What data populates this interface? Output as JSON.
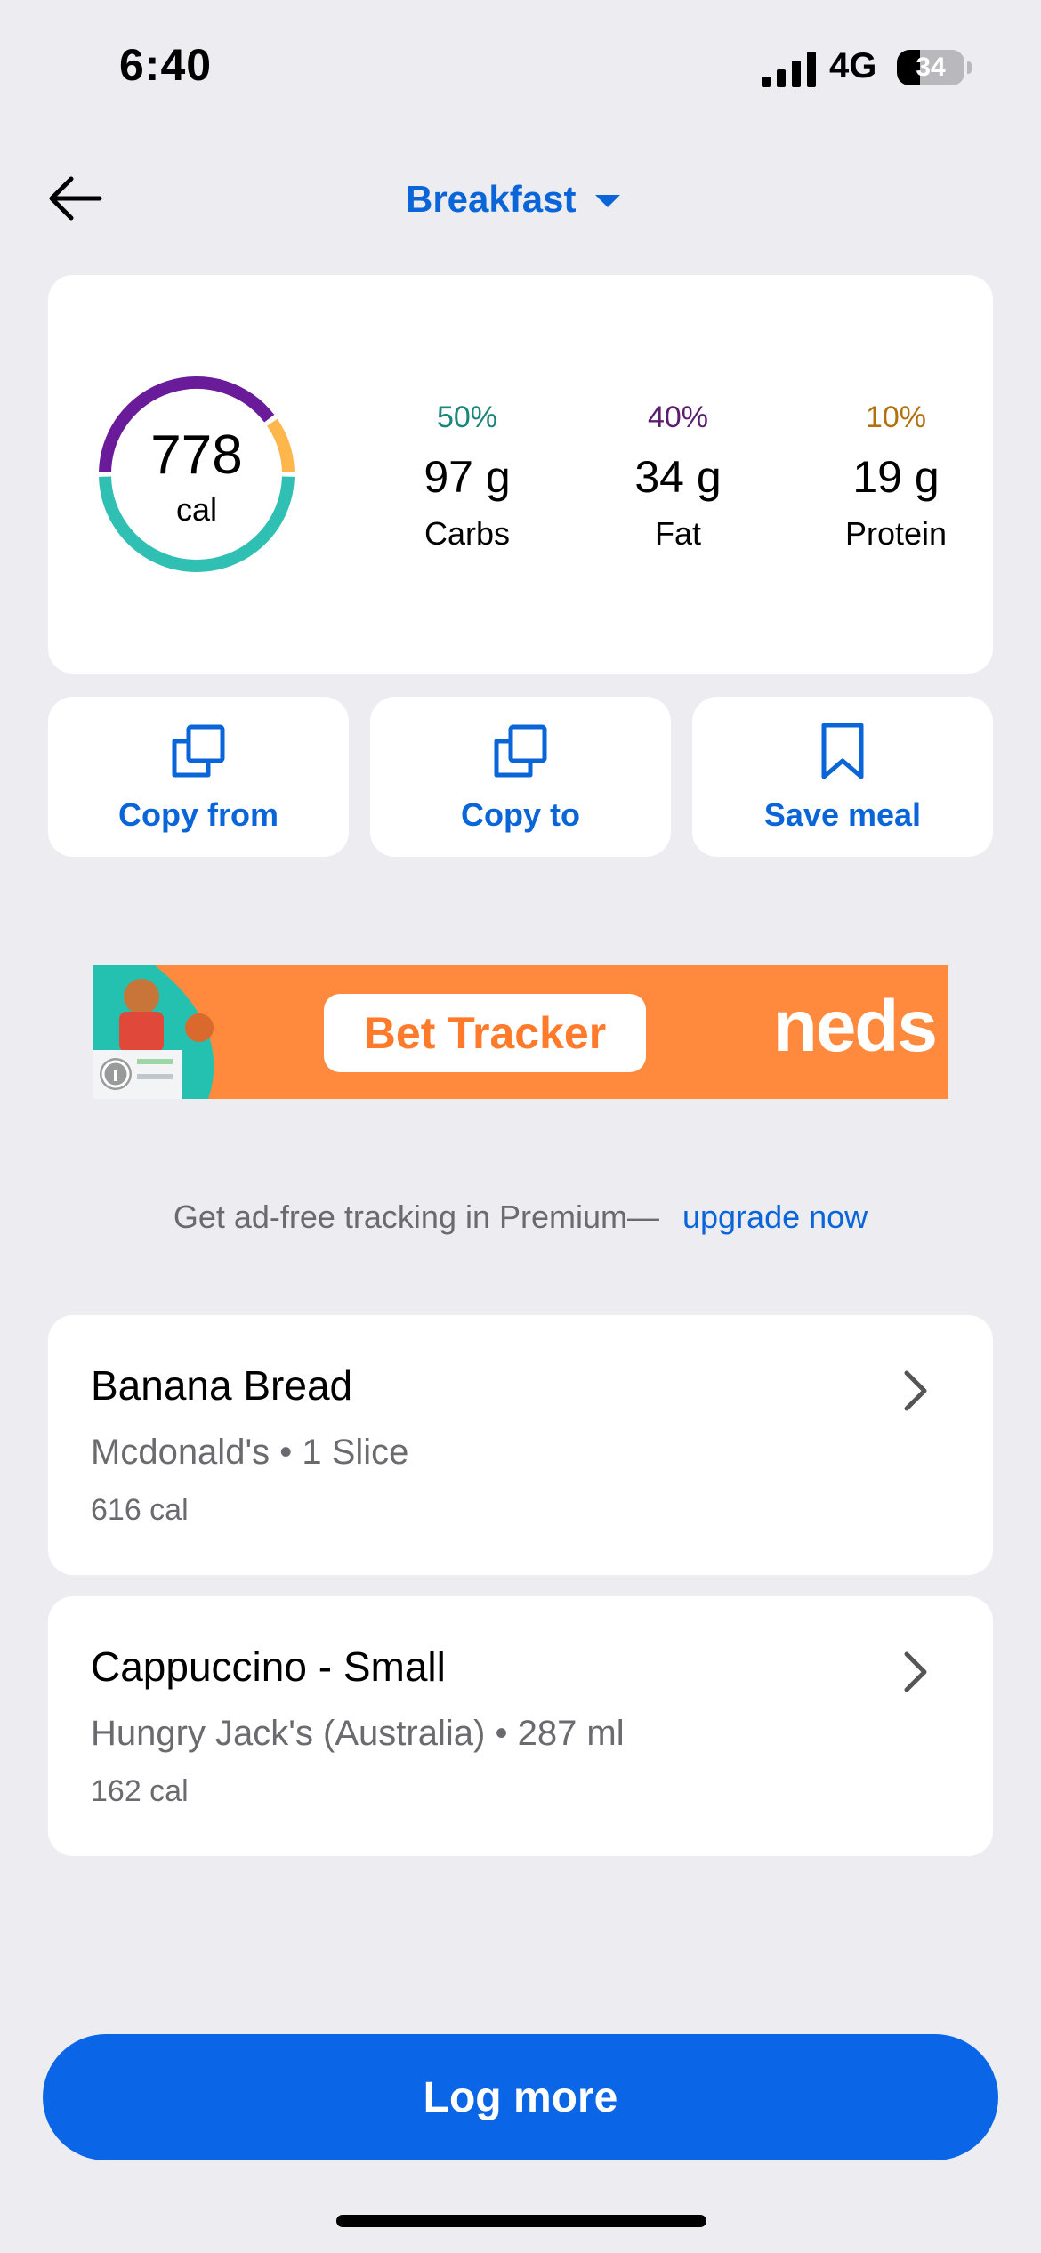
{
  "status_bar": {
    "time": "6:40",
    "network": "4G",
    "battery": "34",
    "battery_level": 0.34
  },
  "header": {
    "meal": "Breakfast"
  },
  "summary": {
    "calories": "778",
    "calories_unit": "cal",
    "macros": [
      {
        "percent": "50%",
        "amount": "97 g",
        "label": "Carbs",
        "color": "#19857b"
      },
      {
        "percent": "40%",
        "amount": "34 g",
        "label": "Fat",
        "color": "#5b1d6e"
      },
      {
        "percent": "10%",
        "amount": "19 g",
        "label": "Protein",
        "color": "#b3700f"
      }
    ],
    "ring_colors": {
      "carbs": "#2fbfb3",
      "fat": "#6a1b9a",
      "protein": "#ffb74d"
    }
  },
  "actions": [
    {
      "label": "Copy from",
      "icon": "copy-icon"
    },
    {
      "label": "Copy to",
      "icon": "copy-icon"
    },
    {
      "label": "Save meal",
      "icon": "bookmark-icon"
    }
  ],
  "ad": {
    "headline": "Bet Tracker",
    "brand": "neds",
    "color": "#ff8a3d"
  },
  "premium_notice": {
    "text": "Get ad-free tracking in Premium—",
    "link": "upgrade now"
  },
  "foods": [
    {
      "name": "Banana Bread",
      "brand": "Mcdonald's",
      "serving": "1 Slice",
      "calories": "616 cal"
    },
    {
      "name": "Cappuccino - Small",
      "brand": "Hungry Jack's (Australia)",
      "serving": "287 ml",
      "calories": "162 cal"
    }
  ],
  "footer": {
    "button": "Log more"
  },
  "accent_color": "#0a66d8"
}
